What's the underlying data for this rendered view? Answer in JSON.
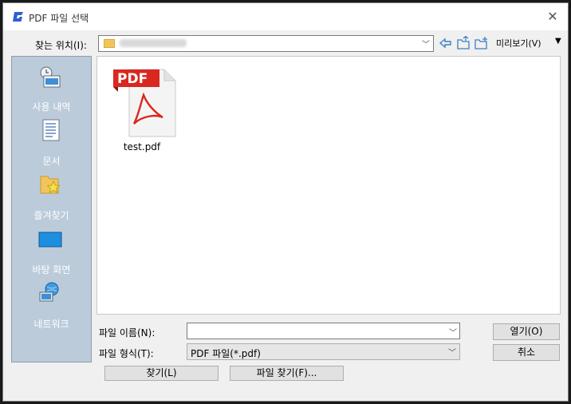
{
  "window": {
    "title": "PDF 파일 선택",
    "close_glyph": "✕"
  },
  "lookin": {
    "label": "찾는 위치(I):"
  },
  "toolbar": {
    "preview_label": "미리보기(V)",
    "menu_glyph": "▼"
  },
  "places": [
    {
      "label": "사용 내역",
      "icon": "recent-icon"
    },
    {
      "label": "문서",
      "icon": "documents-icon"
    },
    {
      "label": "즐겨찾기",
      "icon": "favorites-icon"
    },
    {
      "label": "바탕 화면",
      "icon": "desktop-icon"
    },
    {
      "label": "네트워크",
      "icon": "network-icon"
    }
  ],
  "files": [
    {
      "name": "test.pdf",
      "badge": "PDF",
      "icon": "pdf-file-icon"
    }
  ],
  "filename": {
    "label": "파일 이름(N):",
    "value": ""
  },
  "filetype": {
    "label": "파일 형식(T):",
    "value": "PDF 파일(*.pdf)"
  },
  "buttons": {
    "open": "열기(O)",
    "cancel": "취소",
    "find": "찾기(L)",
    "find_file": "파일 찾기(F)..."
  },
  "colors": {
    "places_bg": "#bccbda",
    "pdf_red": "#d9281f",
    "folder": "#f2c55c"
  }
}
